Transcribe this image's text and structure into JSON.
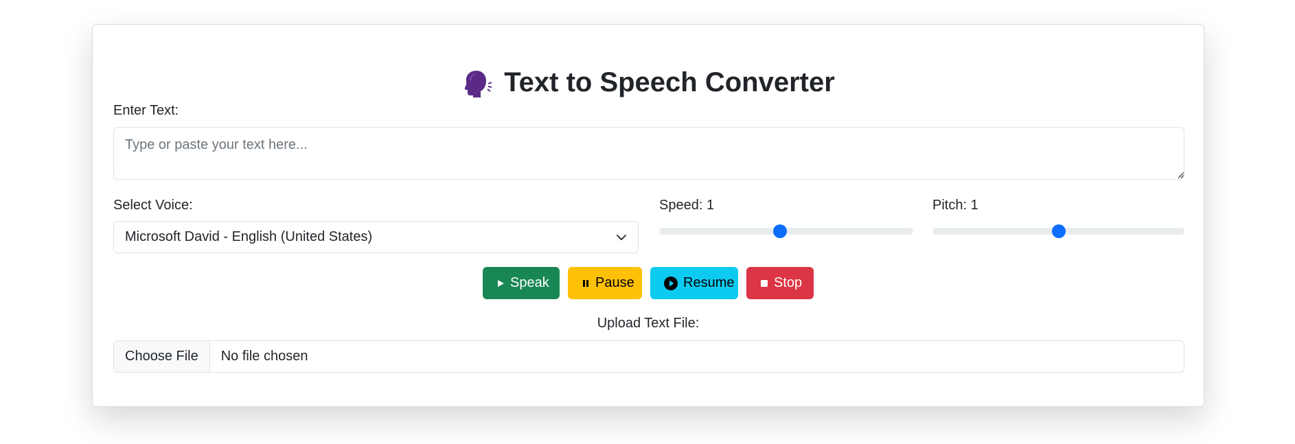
{
  "header": {
    "title": "Text to Speech Converter",
    "icon": "speaking-head-icon",
    "icon_color": "#5b2a86"
  },
  "text_section": {
    "label": "Enter Text:",
    "placeholder": "Type or paste your text here...",
    "value": ""
  },
  "voice": {
    "label": "Select Voice:",
    "selected": "Microsoft David - English (United States)"
  },
  "speed": {
    "label": "Speed: 1",
    "value": 1,
    "min": 0.1,
    "max": 2,
    "slider_color": "#0d6efd"
  },
  "pitch": {
    "label": "Pitch: 1",
    "value": 1,
    "min": 0,
    "max": 2,
    "slider_color": "#0d6efd"
  },
  "buttons": {
    "speak": {
      "label": "Speak",
      "icon": "play-icon",
      "color": "#198754"
    },
    "pause": {
      "label": "Pause",
      "icon": "pause-icon",
      "color": "#ffc107"
    },
    "resume": {
      "label": "Resume",
      "icon": "play-circle-icon",
      "color": "#0dcaf0"
    },
    "stop": {
      "label": "Stop",
      "icon": "stop-icon",
      "color": "#dc3545"
    }
  },
  "upload": {
    "label": "Upload Text File:",
    "button_label": "Choose File",
    "file_name": "No file chosen"
  }
}
